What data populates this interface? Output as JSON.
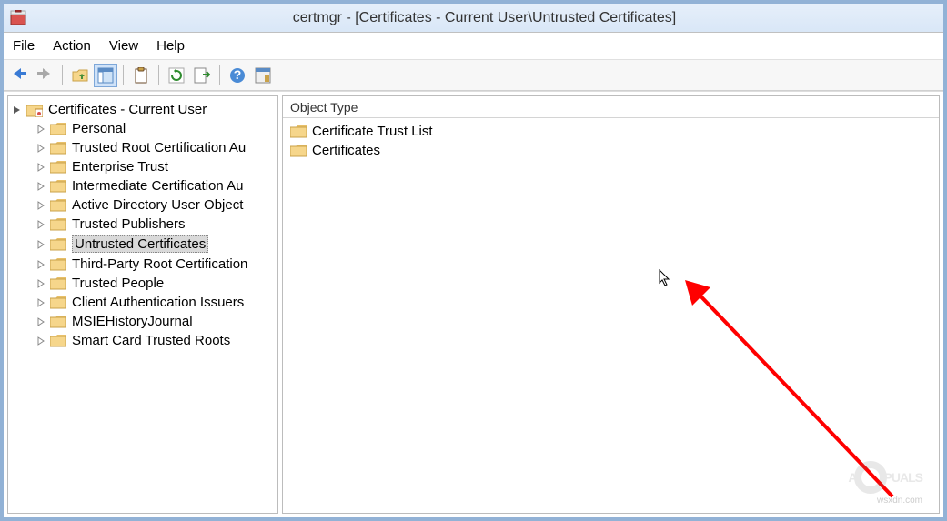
{
  "titlebar": {
    "title": "certmgr - [Certificates - Current User\\Untrusted Certificates]"
  },
  "menubar": {
    "file": "File",
    "action": "Action",
    "view": "View",
    "help": "Help"
  },
  "tree": {
    "root_label": "Certificates - Current User",
    "items": [
      {
        "label": "Personal"
      },
      {
        "label": "Trusted Root Certification Au"
      },
      {
        "label": "Enterprise Trust"
      },
      {
        "label": "Intermediate Certification Au"
      },
      {
        "label": "Active Directory User Object"
      },
      {
        "label": "Trusted Publishers"
      },
      {
        "label": "Untrusted Certificates",
        "selected": true
      },
      {
        "label": "Third-Party Root Certification"
      },
      {
        "label": "Trusted People"
      },
      {
        "label": "Client Authentication Issuers"
      },
      {
        "label": "MSIEHistoryJournal"
      },
      {
        "label": "Smart Card Trusted Roots"
      }
    ]
  },
  "list": {
    "header": "Object Type",
    "items": [
      {
        "label": "Certificate Trust List"
      },
      {
        "label": "Certificates"
      }
    ]
  },
  "watermark": {
    "text1": "A",
    "text2": "PUALS"
  },
  "credit": "wsxdn.com"
}
